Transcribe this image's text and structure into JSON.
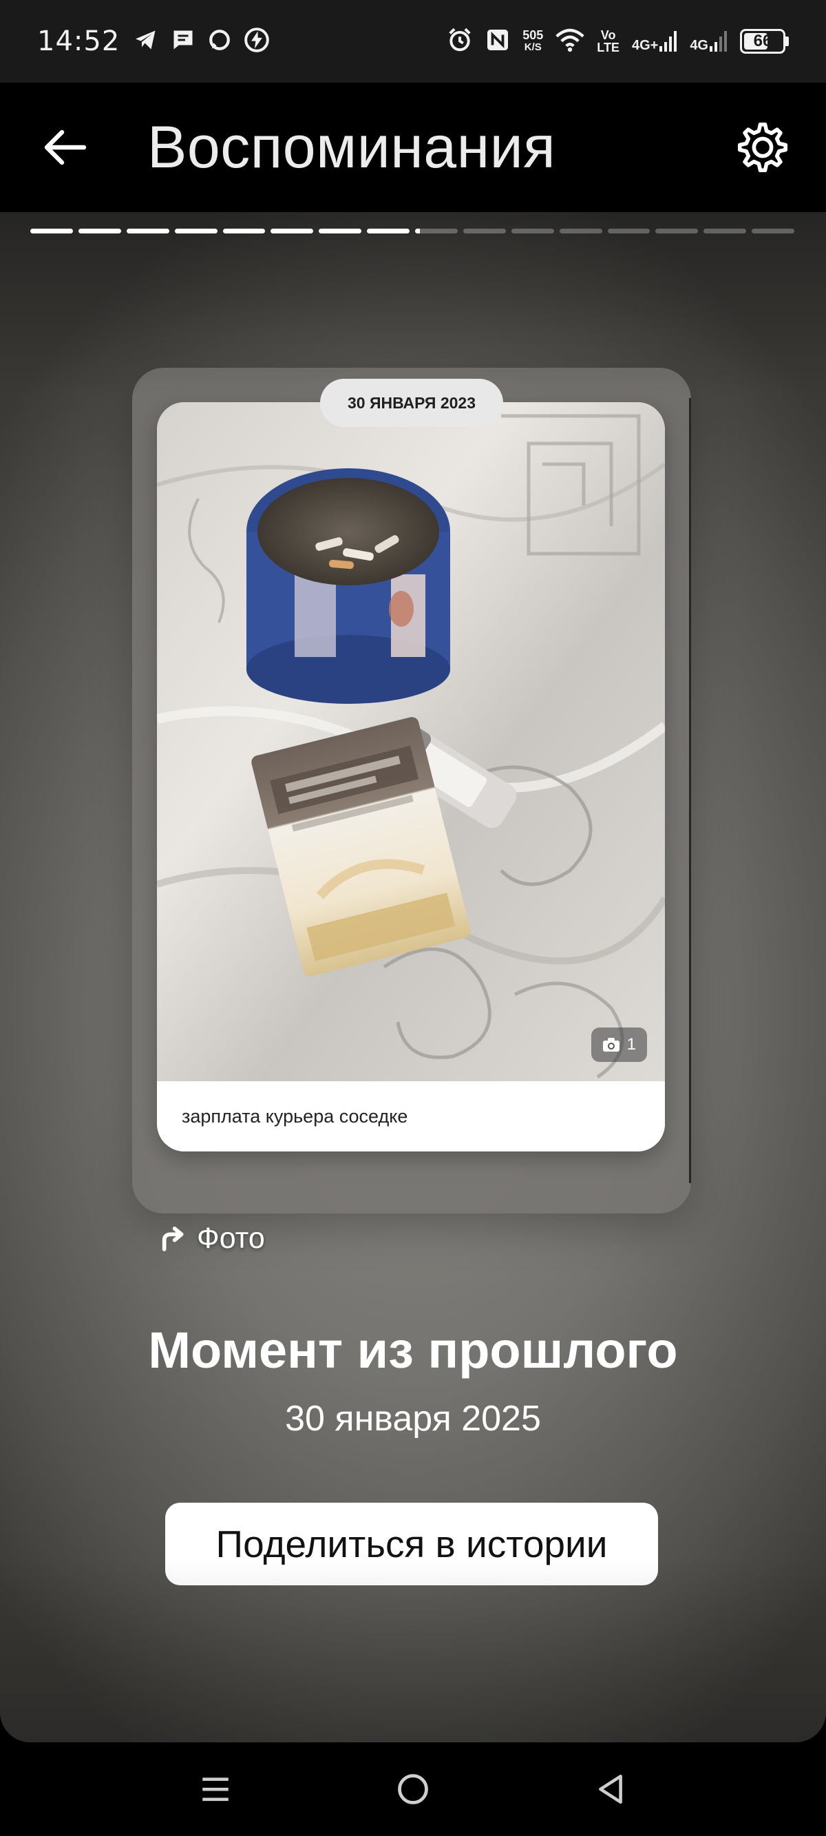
{
  "status_bar": {
    "time": "14:52",
    "speed_value": "505",
    "speed_unit": "K/S",
    "volte_top": "Vo",
    "volte_bottom": "LTE",
    "net1": "4G+",
    "net2": "4G",
    "battery": "66",
    "battery_level": 0.66
  },
  "header": {
    "title": "Воспоминания"
  },
  "story_progress": {
    "total_segments": 16,
    "completed_segments": 8,
    "current_segment_fraction": 0.12
  },
  "memory_card": {
    "date_badge": "30 ЯНВАРЯ 2023",
    "caption": "зарплата курьера соседке",
    "photo_count": "1"
  },
  "source_label": "Фото",
  "moment": {
    "title": "Момент из прошлого",
    "date": "30 января 2025"
  },
  "share_button_label": "Поделиться в истории",
  "icons": {
    "back": "arrow-left-icon",
    "settings": "gear-icon",
    "share_source": "share-arrow-icon",
    "camera": "camera-icon",
    "nav_menu": "menu-icon",
    "nav_home": "home-circle-icon",
    "nav_back": "back-triangle-icon"
  },
  "colors": {
    "header_bg": "#000000",
    "status_bg": "#1a1a1a",
    "button_bg": "#ffffff",
    "pill_bg": "#e8e8e8"
  }
}
